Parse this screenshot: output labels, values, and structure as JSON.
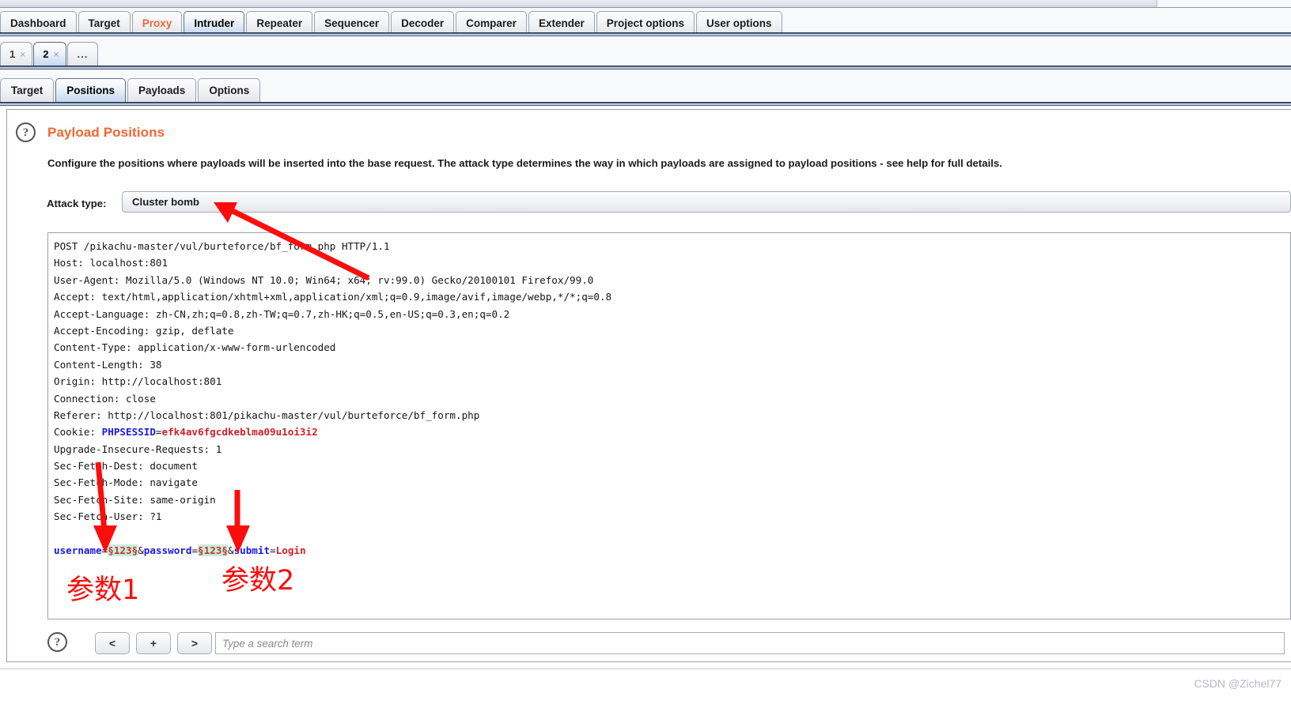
{
  "window": {
    "main_tabs": [
      {
        "label": "Dashboard",
        "active": false,
        "highlight": false
      },
      {
        "label": "Target",
        "active": false,
        "highlight": false
      },
      {
        "label": "Proxy",
        "active": false,
        "highlight": true
      },
      {
        "label": "Intruder",
        "active": true,
        "highlight": false
      },
      {
        "label": "Repeater",
        "active": false,
        "highlight": false
      },
      {
        "label": "Sequencer",
        "active": false,
        "highlight": false
      },
      {
        "label": "Decoder",
        "active": false,
        "highlight": false
      },
      {
        "label": "Comparer",
        "active": false,
        "highlight": false
      },
      {
        "label": "Extender",
        "active": false,
        "highlight": false
      },
      {
        "label": "Project options",
        "active": false,
        "highlight": false
      },
      {
        "label": "User options",
        "active": false,
        "highlight": false
      }
    ],
    "attack_tabs": [
      {
        "label": "1",
        "close": "×",
        "active": false
      },
      {
        "label": "2",
        "close": "×",
        "active": true
      }
    ],
    "attack_tab_more": "...",
    "sub_tabs": [
      {
        "label": "Target",
        "active": false
      },
      {
        "label": "Positions",
        "active": true
      },
      {
        "label": "Payloads",
        "active": false
      },
      {
        "label": "Options",
        "active": false
      }
    ]
  },
  "panel": {
    "help_icon": "?",
    "title": "Payload Positions",
    "description": "Configure the positions where payloads will be inserted into the base request. The attack type determines the way in which payloads are assigned to payload positions - see help for full details.",
    "attack_type_label": "Attack type:",
    "attack_type_value": "Cluster bomb"
  },
  "request": {
    "lines": [
      [
        {
          "t": "POST /pikachu-master/vul/burteforce/bf_form.php HTTP/1.1",
          "c": "plain"
        }
      ],
      [
        {
          "t": "Host: localhost:801",
          "c": "plain"
        }
      ],
      [
        {
          "t": "User-Agent: Mozilla/5.0 (Windows NT 10.0; Win64; x64; rv:99.0) Gecko/20100101 Firefox/99.0",
          "c": "plain"
        }
      ],
      [
        {
          "t": "Accept: text/html,application/xhtml+xml,application/xml;q=0.9,image/avif,image/webp,*/*;q=0.8",
          "c": "plain"
        }
      ],
      [
        {
          "t": "Accept-Language: zh-CN,zh;q=0.8,zh-TW;q=0.7,zh-HK;q=0.5,en-US;q=0.3,en;q=0.2",
          "c": "plain"
        }
      ],
      [
        {
          "t": "Accept-Encoding: gzip, deflate",
          "c": "plain"
        }
      ],
      [
        {
          "t": "Content-Type: application/x-www-form-urlencoded",
          "c": "plain"
        }
      ],
      [
        {
          "t": "Content-Length: 38",
          "c": "plain"
        }
      ],
      [
        {
          "t": "Origin: http://localhost:801",
          "c": "plain"
        }
      ],
      [
        {
          "t": "Connection: close",
          "c": "plain"
        }
      ],
      [
        {
          "t": "Referer: http://localhost:801/pikachu-master/vul/burteforce/bf_form.php",
          "c": "plain"
        }
      ],
      [
        {
          "t": "Cookie: ",
          "c": "plain"
        },
        {
          "t": "PHPSESSID",
          "c": "blue"
        },
        {
          "t": "=",
          "c": "plain"
        },
        {
          "t": "efk4av6fgcdkeblma09u1oi3i2",
          "c": "red"
        }
      ],
      [
        {
          "t": "Upgrade-Insecure-Requests: 1",
          "c": "plain"
        }
      ],
      [
        {
          "t": "Sec-Fetch-Dest: document",
          "c": "plain"
        }
      ],
      [
        {
          "t": "Sec-Fetch-Mode: navigate",
          "c": "plain"
        }
      ],
      [
        {
          "t": "Sec-Fetch-Site: same-origin",
          "c": "plain"
        }
      ],
      [
        {
          "t": "Sec-Fetch-User: ?1",
          "c": "plain"
        }
      ],
      [
        {
          "t": "",
          "c": "plain"
        }
      ],
      [
        {
          "t": "username",
          "c": "blue"
        },
        {
          "t": "=",
          "c": "plain"
        },
        {
          "t": "§123§",
          "c": "mark"
        },
        {
          "t": "&",
          "c": "plain"
        },
        {
          "t": "password",
          "c": "blue"
        },
        {
          "t": "=",
          "c": "plain"
        },
        {
          "t": "§123§",
          "c": "mark"
        },
        {
          "t": "&",
          "c": "plain"
        },
        {
          "t": "submit",
          "c": "blue"
        },
        {
          "t": "=",
          "c": "plain"
        },
        {
          "t": "Login",
          "c": "red"
        }
      ]
    ]
  },
  "annotations": {
    "param1_label": "参数1",
    "param2_label": "参数2",
    "arrow_color": "#fb0d0d"
  },
  "toolbar": {
    "help_icon": "?",
    "prev_label": "<",
    "add_label": "+",
    "next_label": ">",
    "search_placeholder": "Type a search term",
    "search_value": ""
  },
  "watermark": "CSDN @Zichel77"
}
